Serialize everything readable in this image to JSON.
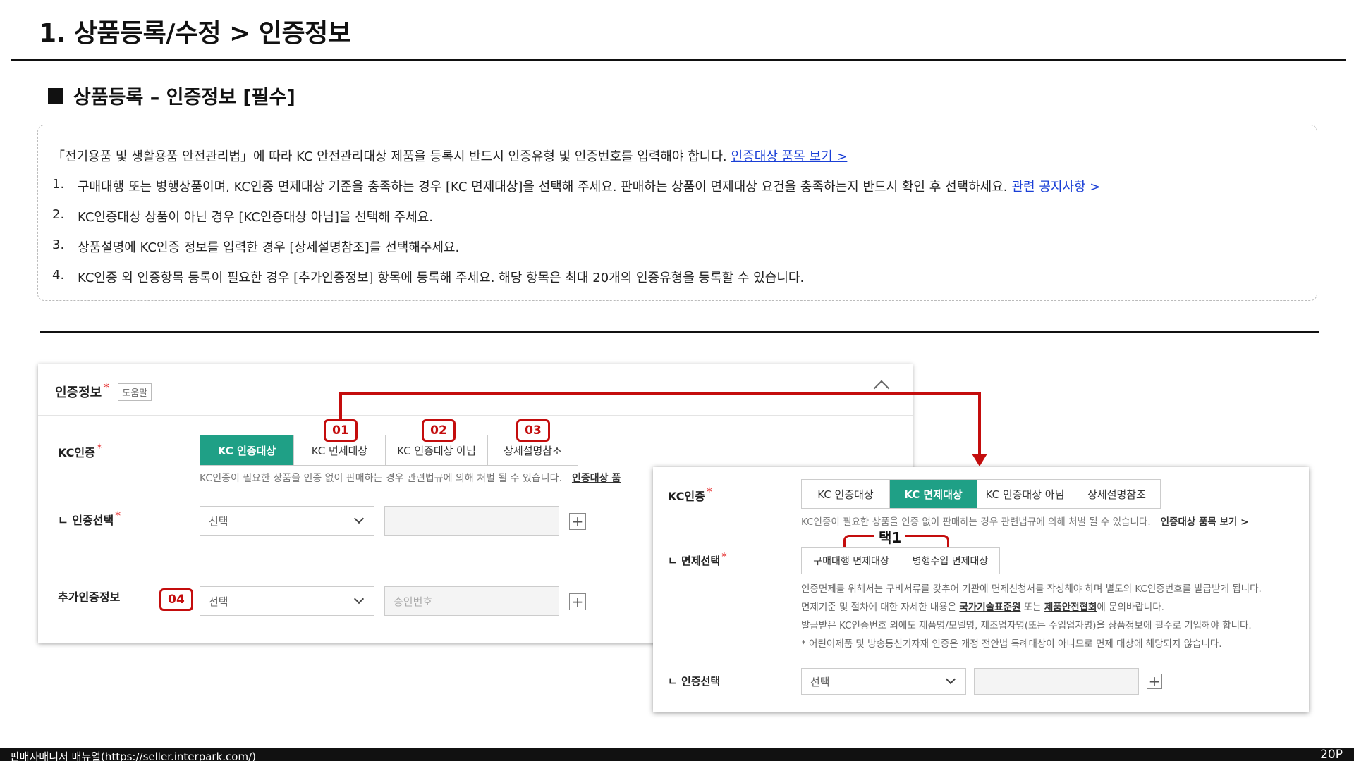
{
  "page": {
    "title": "1. 상품등록/수정 > 인증정보",
    "section_title": "상품등록 – 인증정보 [필수]"
  },
  "notice": {
    "intro": "「전기용품 및 생활용품 안전관리법」에 따라 KC 안전관리대상 제품을 등록시 반드시 인증유형 및 인증번호를 입력해야 합니다.",
    "intro_link": "인증대상 품목 보기 >",
    "items": [
      {
        "num": "1.",
        "text": "구매대행 또는 병행상품이며, KC인증 면제대상 기준을 충족하는 경우 [KC 면제대상]을 선택해 주세요. 판매하는 상품이 면제대상 요건을 충족하는지 반드시 확인 후 선택하세요.",
        "link": "관련 공지사항 >"
      },
      {
        "num": "2.",
        "text": "KC인증대상 상품이 아닌 경우 [KC인증대상 아님]을 선택해 주세요.",
        "link": ""
      },
      {
        "num": "3.",
        "text": "상품설명에 KC인증 정보를 입력한 경우 [상세설명참조]를 선택해주세요.",
        "link": ""
      },
      {
        "num": "4.",
        "text": "KC인증 외 인증항목 등록이 필요한 경우 [추가인증정보] 항목에 등록해 주세요. 해당 항목은 최대 20개의 인증유형을 등록할 수 있습니다.",
        "link": ""
      }
    ]
  },
  "left_panel": {
    "header": "인증정보",
    "required_mark": "*",
    "help_tag": "도움말",
    "kc_label": "KC인증",
    "kc_options": [
      "KC 인증대상",
      "KC 면제대상",
      "KC 인증대상 아님",
      "상세설명참조"
    ],
    "kc_active_index": 0,
    "kc_desc": "KC인증이 필요한 상품을 인증 없이 판매하는 경우 관련법규에 의해 처벌 될 수 있습니다.",
    "kc_desc_link": "인증대상 품",
    "cert_select_label": "ㄴ 인증선택",
    "cert_select_value": "선택",
    "extra_label": "추가인증정보",
    "extra_select_value": "선택",
    "extra_input_placeholder": "승인번호",
    "badges": [
      "01",
      "02",
      "03",
      "04"
    ]
  },
  "right_panel": {
    "kc_label": "KC인증",
    "kc_options": [
      "KC 인증대상",
      "KC 면제대상",
      "KC 인증대상 아님",
      "상세설명참조"
    ],
    "kc_active_index": 1,
    "kc_desc": "KC인증이 필요한 상품을 인증 없이 판매하는 경우 관련법규에 의해 처벌 될 수 있습니다.",
    "kc_desc_link": "인증대상 품목 보기 >",
    "exempt_label": "ㄴ 면제선택",
    "exempt_options": [
      "구매대행 면제대상",
      "병행수입 면제대상"
    ],
    "choose_one": "택1",
    "exempt_lines": [
      {
        "pre": "인증면제를 위해서는 구비서류를 갖추어 기관에 면제신청서를 작성해야 하며 별도의 KC인증번호를 발급받게 됩니다.",
        "b1": "",
        "mid": "",
        "b2": "",
        "post": ""
      },
      {
        "pre": "면제기준 및 절차에 대한 자세한 내용은 ",
        "b1": "국가기술표준원",
        "mid": " 또는 ",
        "b2": "제품안전협회",
        "post": "에 문의바랍니다."
      },
      {
        "pre": "발급받은 KC인증번호 외에도 제품명/모델명, 제조업자명(또는 수입업자명)을 상품정보에 필수로 기입해야 합니다.",
        "b1": "",
        "mid": "",
        "b2": "",
        "post": ""
      },
      {
        "pre": "* 어린이제품 및 방송통신기자재 인증은 개정 전안법 특례대상이 아니므로 면제 대상에 해당되지 않습니다.",
        "b1": "",
        "mid": "",
        "b2": "",
        "post": ""
      }
    ],
    "cert_select_label": "ㄴ 인증선택",
    "cert_select_value": "선택"
  },
  "footer": {
    "left": "판매자매니저 매뉴얼(https://seller.interpark.com/)",
    "right": "20P"
  },
  "colors": {
    "accent_green": "#1fa086",
    "badge_red": "#c40d0d",
    "link_blue": "#1a3fd6"
  }
}
